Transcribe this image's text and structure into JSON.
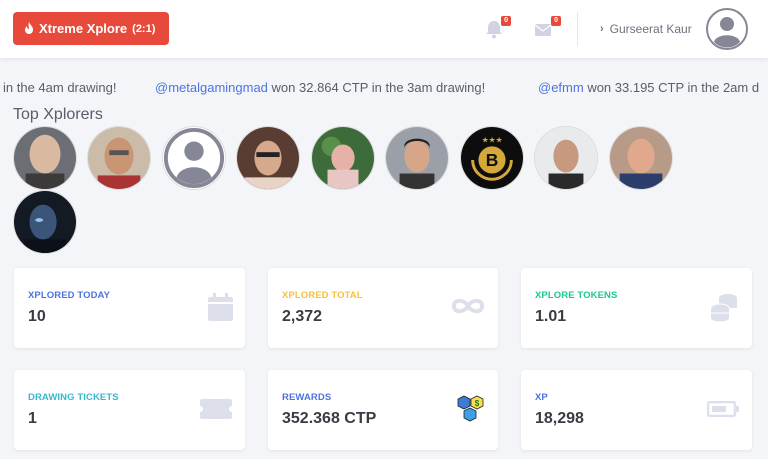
{
  "header": {
    "xplore_button": {
      "label": "Xtreme Xplore",
      "ratio": "(2:1)"
    },
    "notifications_badge": "0",
    "messages_badge": "0",
    "user_name": "Gurseerat Kaur"
  },
  "ticker": {
    "items": [
      {
        "handle": "",
        "text": "in the 4am drawing!"
      },
      {
        "handle": "@metalgamingmad",
        "text": " won 32.864 CTP in the 3am drawing!"
      },
      {
        "handle": "@efmm",
        "text": " won 33.195 CTP in the 2am d"
      }
    ]
  },
  "top_xplorers": {
    "title": "Top Xplorers",
    "avatars": [
      {
        "icon": "avatar-photo"
      },
      {
        "icon": "avatar-photo"
      },
      {
        "icon": "default-avatar-icon"
      },
      {
        "icon": "avatar-photo"
      },
      {
        "icon": "avatar-photo"
      },
      {
        "icon": "avatar-photo"
      },
      {
        "icon": "bitcoin-laurel-icon"
      },
      {
        "icon": "avatar-photo"
      },
      {
        "icon": "avatar-photo"
      },
      {
        "icon": "avatar-photo"
      }
    ]
  },
  "stats": [
    {
      "label": "XPLORED TODAY",
      "value": "10",
      "color": "#4e73df",
      "icon": "calendar-icon"
    },
    {
      "label": "XPLORED TOTAL",
      "value": "2,372",
      "color": "#f6c23e",
      "icon": "infinity-icon"
    },
    {
      "label": "XPLORE TOKENS",
      "value": "1.01",
      "color": "#1cc88a",
      "icon": "coins-icon"
    },
    {
      "label": "DRAWING TICKETS",
      "value": "1",
      "color": "#36b9cc",
      "icon": "ticket-icon"
    },
    {
      "label": "REWARDS",
      "value": "352.368 CTP",
      "color": "#4e73df",
      "icon": "crypto-hexagon-icon"
    },
    {
      "label": "XP",
      "value": "18,298",
      "color": "#4e73df",
      "icon": "battery-icon"
    }
  ],
  "colors": {
    "danger": "#e74a3b",
    "primary": "#4e73df",
    "background": "#f3f5f9"
  }
}
